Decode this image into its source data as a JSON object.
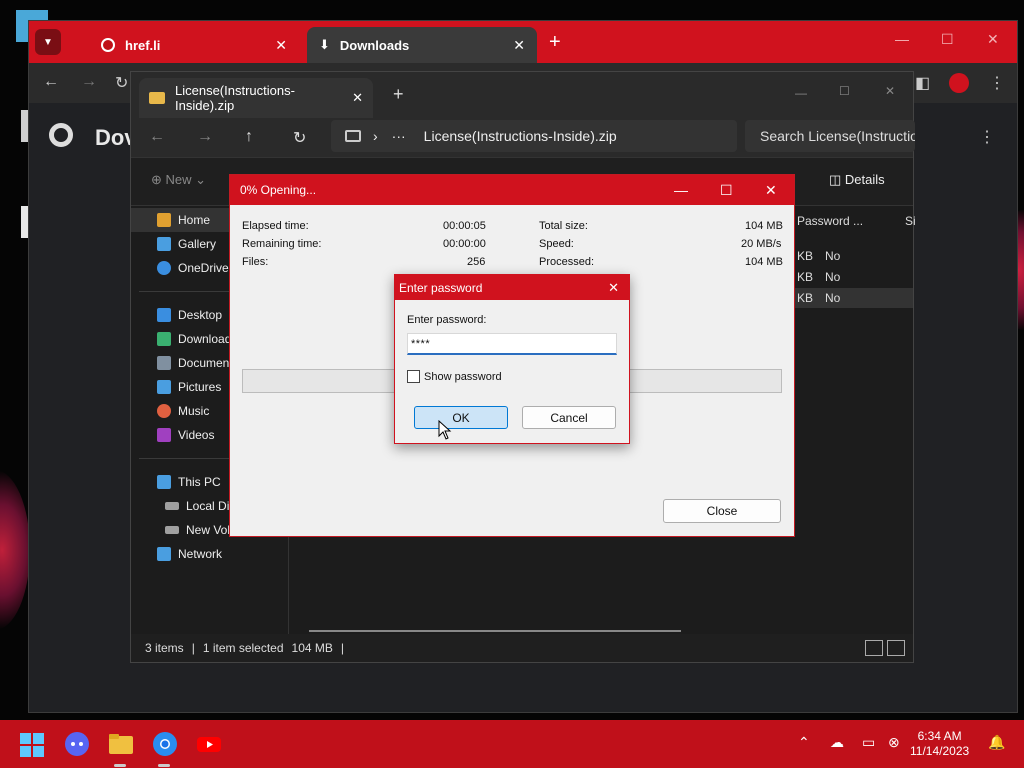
{
  "chrome": {
    "tabs": [
      {
        "label": "href.li",
        "close": "✕"
      },
      {
        "label": "Downloads",
        "close": "✕"
      }
    ],
    "new_tab": "+",
    "page_title": "Dov"
  },
  "explorer": {
    "tab_label": "License(Instructions-Inside).zip",
    "tab_close": "✕",
    "new_tab": "+",
    "address_ellipsis": "···",
    "address_path": "License(Instructions-Inside).zip",
    "search_placeholder": "Search License(Instructions-Inside).zip",
    "toolbar_new": "New",
    "toolbar_details": "Details",
    "sidebar": [
      {
        "label": "Home",
        "color": "#e0a030"
      },
      {
        "label": "Gallery",
        "color": "#4a9ee0"
      },
      {
        "label": "OneDrive",
        "color": "#3a8ee0"
      },
      {
        "label": "Desktop",
        "color": "#3a8ee0"
      },
      {
        "label": "Downloads",
        "color": "#3ab070"
      },
      {
        "label": "Documents",
        "color": "#8090a0"
      },
      {
        "label": "Pictures",
        "color": "#4a9ee0"
      },
      {
        "label": "Music",
        "color": "#e06040"
      },
      {
        "label": "Videos",
        "color": "#a040c0"
      },
      {
        "label": "This PC",
        "color": "#4a9ee0"
      },
      {
        "label": "Local Disk (C:)",
        "color": "#a0a0a0"
      },
      {
        "label": "New Volume (E:)",
        "color": "#a0a0a0"
      },
      {
        "label": "Network",
        "color": "#4a9ee0"
      }
    ],
    "columns": [
      "Password ...",
      "Si"
    ],
    "rows": [
      {
        "size": "KB",
        "password": "No"
      },
      {
        "size": "KB",
        "password": "No"
      },
      {
        "size": "KB",
        "password": "No"
      }
    ],
    "status": {
      "items": "3 items",
      "selected": "1 item selected",
      "size": "104 MB"
    }
  },
  "opening_dialog": {
    "title": "0% Opening...",
    "stats": [
      {
        "label": "Elapsed time:",
        "value": "00:00:05"
      },
      {
        "label": "Remaining time:",
        "value": "00:00:00"
      },
      {
        "label": "Files:",
        "value": "256"
      }
    ],
    "stats_right": [
      {
        "label": "Total size:",
        "value": "104 MB"
      },
      {
        "label": "Speed:",
        "value": "20 MB/s"
      },
      {
        "label": "Processed:",
        "value": "104 MB"
      }
    ],
    "progress": 0,
    "close_label": "Close"
  },
  "password_dialog": {
    "title": "Enter password",
    "field_label": "Enter password:",
    "field_value": "****",
    "show_password_label": "Show password",
    "show_password_checked": false,
    "ok_label": "OK",
    "cancel_label": "Cancel"
  },
  "taskbar": {
    "time": "6:34 AM",
    "date": "11/14/2023"
  },
  "colors": {
    "accent": "#d0121e",
    "taskbar": "#c0101a"
  }
}
